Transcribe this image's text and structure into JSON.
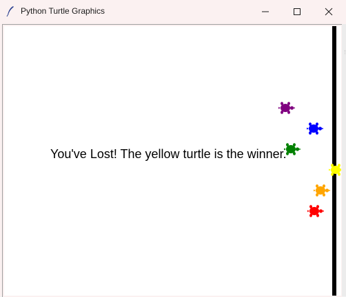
{
  "window": {
    "title": "Python Turtle Graphics",
    "icon": "feather-icon",
    "controls": [
      "minimize-icon",
      "maximize-icon",
      "close-icon"
    ]
  },
  "canvas": {
    "message": "You've Lost! The yellow turtle is the winner.",
    "background": "#ffffff",
    "finish_line_color": "#000000"
  },
  "turtles": [
    {
      "color": "purple",
      "hex": "#800080"
    },
    {
      "color": "blue",
      "hex": "#0000ff"
    },
    {
      "color": "green",
      "hex": "#008000"
    },
    {
      "color": "yellow",
      "hex": "#ffff00"
    },
    {
      "color": "orange",
      "hex": "#ffa500"
    },
    {
      "color": "red",
      "hex": "#ff0000"
    }
  ]
}
